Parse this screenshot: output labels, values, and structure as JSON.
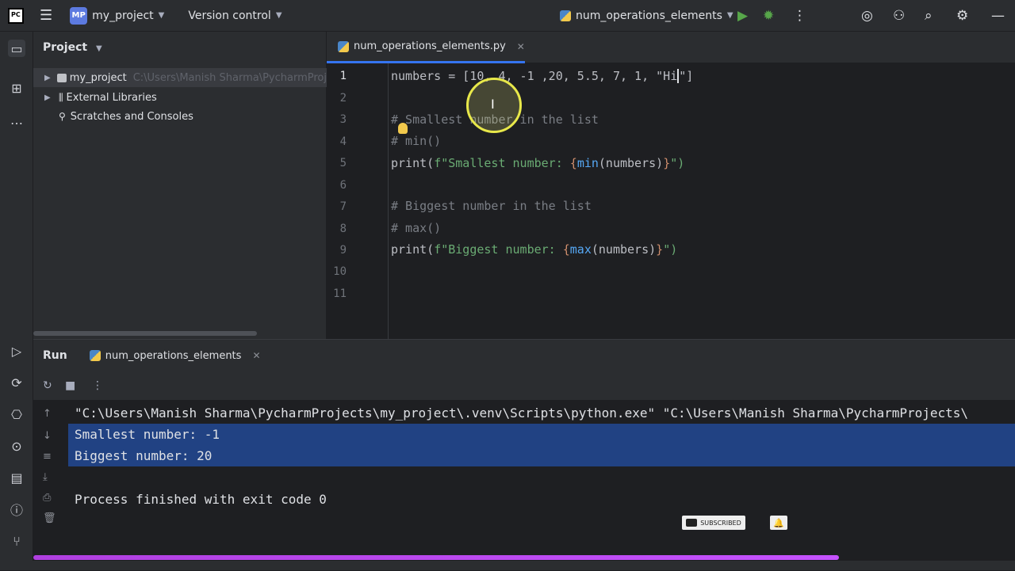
{
  "topbar": {
    "logo": "PC",
    "project_badge": "MP",
    "project_name": "my_project",
    "vcs_label": "Version control",
    "run_config": "num_operations_elements",
    "icons": [
      "menu-icon",
      "run-icon",
      "debug-icon",
      "more-icon",
      "ai-assistant-icon",
      "add-user-icon",
      "search-icon",
      "settings-icon",
      "minimize-icon"
    ]
  },
  "project_panel": {
    "title": "Project",
    "items": [
      {
        "label": "my_project",
        "path": "C:\\Users\\Manish Sharma\\PycharmProj"
      },
      {
        "label": "External Libraries"
      },
      {
        "label": "Scratches and Consoles"
      }
    ]
  },
  "editor": {
    "tab_label": "num_operations_elements.py",
    "line_numbers": [
      "1",
      "2",
      "3",
      "4",
      "5",
      "6",
      "7",
      "8",
      "9",
      "10",
      "11"
    ],
    "lines": {
      "l1_a": "numbers = [10, 4, -1 ,20, 5.5, 7, 1, \"Hi",
      "l1_b": "\"]",
      "l3": "# Smallest number in the list",
      "l4": "# min()",
      "l5_print": "print(",
      "l5_str": "f\"Smallest number: ",
      "l5_open": "{",
      "l5_fn": "min",
      "l5_arg": "(numbers)",
      "l5_close": "}",
      "l5_end": "\")",
      "l7": "# Biggest number in the list",
      "l8": "# max()",
      "l9_print": "print(",
      "l9_str": "f\"Biggest number: ",
      "l9_open": "{",
      "l9_fn": "max",
      "l9_arg": "(numbers)",
      "l9_close": "}",
      "l9_end": "\")"
    }
  },
  "run_panel": {
    "title": "Run",
    "tab_label": "num_operations_elements",
    "output": [
      "\"C:\\Users\\Manish Sharma\\PycharmProjects\\my_project\\.venv\\Scripts\\python.exe\" \"C:\\Users\\Manish Sharma\\PycharmProjects\\",
      "Smallest number: -1",
      "Biggest number: 20",
      "",
      "Process finished with exit code 0"
    ]
  },
  "overlay": {
    "subscribed_label": "SUBSCRIBED"
  }
}
